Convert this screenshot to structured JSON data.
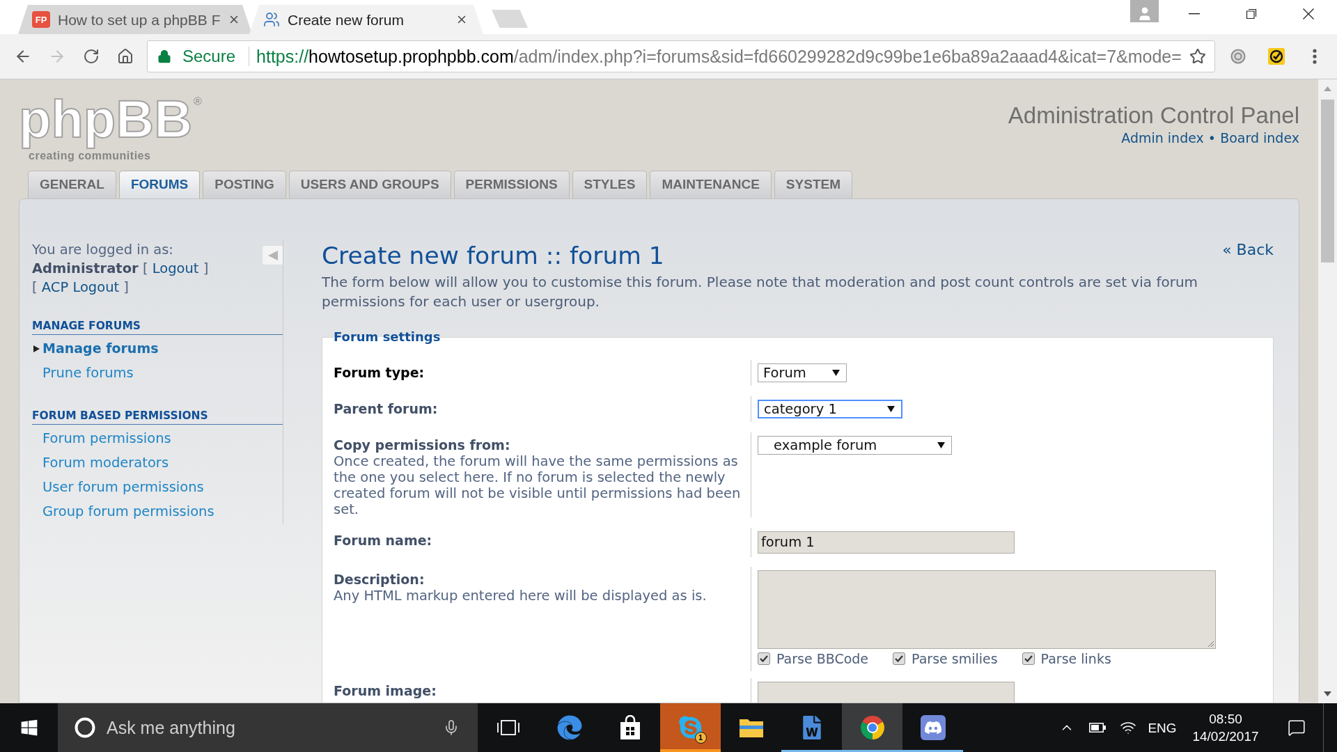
{
  "browser": {
    "tabs": [
      {
        "title": "How to set up a phpBB F",
        "selected": false,
        "favicon": {
          "kind": "letters",
          "text": "FP"
        }
      },
      {
        "title": "Create new forum",
        "selected": true,
        "favicon": {
          "kind": "people"
        }
      }
    ],
    "can_go_forward": false,
    "security_label": "Secure",
    "url": {
      "scheme": "https://",
      "host": "howtosetup.prophpbb.com",
      "path": "/adm/index.php?i=forums&sid=fd660299282d9c99be1e6ba89a2aaad4&icat=7&mode="
    }
  },
  "header": {
    "logo": {
      "wordmark": "phpBB",
      "mark": "®",
      "tagline": "creating communities"
    },
    "title": "Administration Control Panel",
    "links": [
      "Admin index",
      "Board index"
    ],
    "link_separator": "•"
  },
  "nav_tabs": [
    {
      "label": "GENERAL",
      "selected": false
    },
    {
      "label": "FORUMS",
      "selected": true
    },
    {
      "label": "POSTING",
      "selected": false
    },
    {
      "label": "USERS AND GROUPS",
      "selected": false
    },
    {
      "label": "PERMISSIONS",
      "selected": false
    },
    {
      "label": "STYLES",
      "selected": false
    },
    {
      "label": "MAINTENANCE",
      "selected": false
    },
    {
      "label": "SYSTEM",
      "selected": false
    }
  ],
  "sidebar": {
    "login": {
      "intro": "You are logged in as:",
      "user": "Administrator",
      "links": [
        {
          "open": "[",
          "label": "Logout",
          "close": "]"
        },
        {
          "open": "[",
          "label": "ACP Logout",
          "close": "]"
        }
      ]
    },
    "sections": [
      {
        "title": "MANAGE FORUMS",
        "items": [
          {
            "label": "Manage forums",
            "selected": true
          },
          {
            "label": "Prune forums",
            "selected": false
          }
        ]
      },
      {
        "title": "FORUM BASED PERMISSIONS",
        "items": [
          {
            "label": "Forum permissions",
            "selected": false
          },
          {
            "label": "Forum moderators",
            "selected": false
          },
          {
            "label": "User forum permissions",
            "selected": false
          },
          {
            "label": "Group forum permissions",
            "selected": false
          }
        ]
      }
    ]
  },
  "content": {
    "title": "Create new forum :: forum 1",
    "back_link": "« Back",
    "intro": "The form below will allow you to customise this forum. Please note that moderation and post count controls are set via forum permissions for each user or usergroup.",
    "fieldset": {
      "legend": "Forum settings",
      "rows": [
        {
          "kind": "select",
          "label": "Forum type:",
          "hovered": true,
          "focused": false,
          "value": "Forum"
        },
        {
          "kind": "select",
          "label": "Parent forum:",
          "hovered": false,
          "focused": true,
          "value": "category 1"
        },
        {
          "kind": "select",
          "label": "Copy permissions from:",
          "explain": "Once created, the forum will have the same permissions as the one you select here. If no forum is selected the newly created forum will not be visible until permissions had been set.",
          "hovered": false,
          "focused": false,
          "value": "example forum"
        },
        {
          "kind": "text",
          "label": "Forum name:",
          "hovered": false,
          "focused": false,
          "value": "forum 1"
        },
        {
          "kind": "textarea",
          "label": "Description:",
          "explain": "Any HTML markup entered here will be displayed as is.",
          "hovered": false,
          "focused": false,
          "options": [
            {
              "label": "Parse BBCode",
              "checked": true
            },
            {
              "label": "Parse smilies",
              "checked": true
            },
            {
              "label": "Parse links",
              "checked": true
            }
          ]
        },
        {
          "kind": "text",
          "label": "Forum image:",
          "hovered": false,
          "focused": false
        }
      ]
    }
  },
  "taskbar": {
    "search_placeholder": "Ask me anything",
    "apps": [
      {
        "kind": "edge",
        "running": false,
        "active": false,
        "flashing": false
      },
      {
        "kind": "store",
        "running": false,
        "active": false,
        "flashing": false
      },
      {
        "kind": "skype",
        "running": false,
        "active": false,
        "flashing": true,
        "badge": "1"
      },
      {
        "kind": "explorer",
        "running": false,
        "active": false,
        "flashing": false
      },
      {
        "kind": "word",
        "running": true,
        "active": false,
        "flashing": false
      },
      {
        "kind": "chrome",
        "running": true,
        "active": true,
        "flashing": false
      },
      {
        "kind": "discord",
        "running": true,
        "active": false,
        "flashing": false
      }
    ],
    "language": "ENG",
    "time": "08:50",
    "date": "14/02/2017"
  }
}
